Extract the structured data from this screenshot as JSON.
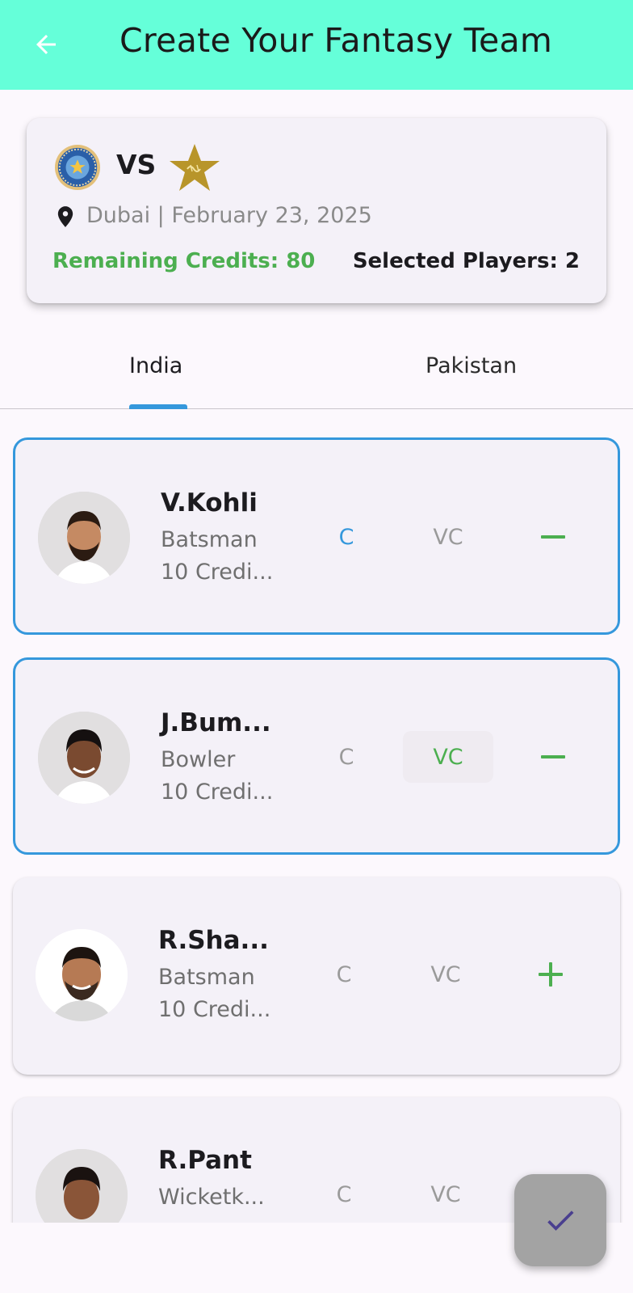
{
  "appbar": {
    "title": "Create Your Fantasy Team",
    "back_icon": "arrow-left-icon"
  },
  "match": {
    "team1_logo": "india-crest-icon",
    "vs": "VS",
    "team2_logo": "pakistan-star-icon",
    "location_icon": "location-pin-icon",
    "venue_date": "Dubai | February 23, 2025",
    "remaining_credits": "Remaining Credits: 80",
    "selected_players": "Selected Players: 2"
  },
  "tabs": [
    {
      "label": "India",
      "active": true
    },
    {
      "label": "Pakistan",
      "active": false
    }
  ],
  "players": [
    {
      "name": "V.Kohli",
      "role": "Batsman",
      "credits": "10 Credi...",
      "captain_label": "C",
      "vice_captain_label": "VC",
      "selected": true,
      "is_captain": true,
      "is_vice_captain": false,
      "action_icon": "minus-icon"
    },
    {
      "name": "J.Bum...",
      "role": "Bowler",
      "credits": "10 Credi...",
      "captain_label": "C",
      "vice_captain_label": "VC",
      "selected": true,
      "is_captain": false,
      "is_vice_captain": true,
      "action_icon": "minus-icon"
    },
    {
      "name": "R.Sha...",
      "role": "Batsman",
      "credits": "10 Credi...",
      "captain_label": "C",
      "vice_captain_label": "VC",
      "selected": false,
      "is_captain": false,
      "is_vice_captain": false,
      "action_icon": "plus-icon"
    },
    {
      "name": "R.Pant",
      "role": "Wicketk...",
      "credits": "",
      "captain_label": "C",
      "vice_captain_label": "VC",
      "selected": false,
      "is_captain": false,
      "is_vice_captain": false,
      "action_icon": "plus-icon"
    }
  ],
  "fab": {
    "icon": "check-icon"
  },
  "colors": {
    "appbar": "#65ffd9",
    "accent_blue": "#3598dc",
    "accent_green": "#4caf50",
    "fab": "#a3a3a3"
  }
}
